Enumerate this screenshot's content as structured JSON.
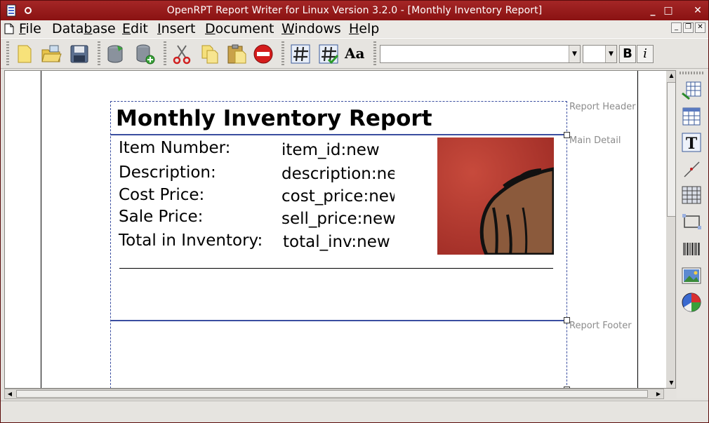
{
  "window": {
    "title": "OpenRPT Report Writer for Linux Version 3.2.0 - [Monthly Inventory Report]",
    "accent": "#9a1a1a"
  },
  "menu": [
    {
      "pre": "",
      "key": "F",
      "post": "ile"
    },
    {
      "pre": "Data",
      "key": "b",
      "post": "ase"
    },
    {
      "pre": "",
      "key": "E",
      "post": "dit"
    },
    {
      "pre": "",
      "key": "I",
      "post": "nsert"
    },
    {
      "pre": "",
      "key": "D",
      "post": "ocument"
    },
    {
      "pre": "",
      "key": "W",
      "post": "indows"
    },
    {
      "pre": "",
      "key": "H",
      "post": "elp"
    }
  ],
  "toolbar": {
    "icons": [
      "new-icon",
      "open-icon",
      "save-icon",
      "database-icon",
      "query-add-icon",
      "cut-icon",
      "copy-icon",
      "paste-icon",
      "delete-icon",
      "grid-icon",
      "snap-grid-icon",
      "font-icon"
    ],
    "font_label": "Aa",
    "font_value": "",
    "size_value": "",
    "bold_label": "B",
    "italic_label": "i"
  },
  "report": {
    "title": "Monthly Inventory Report",
    "sections": {
      "header": "Report Header",
      "detail": "Main Detail",
      "footer": "Report Footer"
    },
    "fields": [
      {
        "label": "Item Number:",
        "value": "item_id:new"
      },
      {
        "label": "Description:",
        "value": "description:new"
      },
      {
        "label": "Cost Price:",
        "value": "cost_price:new"
      },
      {
        "label": "Sale Price:",
        "value": "sell_price:new"
      },
      {
        "label": "Total in Inventory:",
        "value": "total_inv:new"
      }
    ]
  },
  "palette": [
    "insert-label-icon",
    "insert-field-icon",
    "insert-text-icon",
    "insert-line-icon",
    "insert-crosstab-icon",
    "insert-rectangle-icon",
    "insert-barcode-icon",
    "insert-image-icon",
    "insert-graph-icon"
  ]
}
